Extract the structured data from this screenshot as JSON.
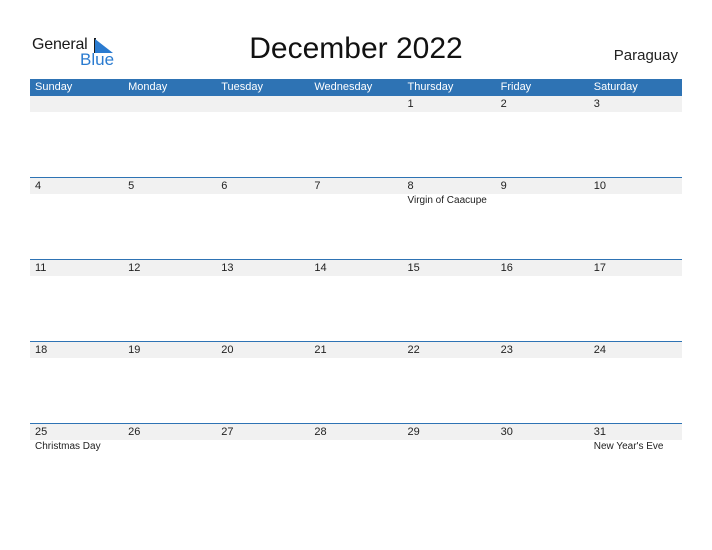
{
  "logo": {
    "word1": "General",
    "word2": "Blue"
  },
  "title": "December 2022",
  "country": "Paraguay",
  "accent_color": "#2e73b4",
  "weekdays": [
    "Sunday",
    "Monday",
    "Tuesday",
    "Wednesday",
    "Thursday",
    "Friday",
    "Saturday"
  ],
  "weeks": [
    {
      "days": [
        "",
        "",
        "",
        "",
        "1",
        "2",
        "3"
      ],
      "events": [
        "",
        "",
        "",
        "",
        "",
        "",
        ""
      ]
    },
    {
      "days": [
        "4",
        "5",
        "6",
        "7",
        "8",
        "9",
        "10"
      ],
      "events": [
        "",
        "",
        "",
        "",
        "Virgin of Caacupe",
        "",
        ""
      ]
    },
    {
      "days": [
        "11",
        "12",
        "13",
        "14",
        "15",
        "16",
        "17"
      ],
      "events": [
        "",
        "",
        "",
        "",
        "",
        "",
        ""
      ]
    },
    {
      "days": [
        "18",
        "19",
        "20",
        "21",
        "22",
        "23",
        "24"
      ],
      "events": [
        "",
        "",
        "",
        "",
        "",
        "",
        ""
      ]
    },
    {
      "days": [
        "25",
        "26",
        "27",
        "28",
        "29",
        "30",
        "31"
      ],
      "events": [
        "Christmas Day",
        "",
        "",
        "",
        "",
        "",
        "New Year's Eve"
      ]
    }
  ]
}
